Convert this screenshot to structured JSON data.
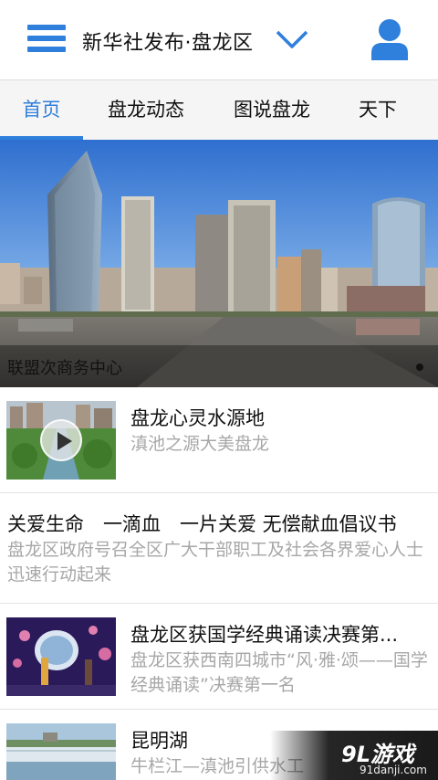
{
  "header": {
    "title": "新华社发布·盘龙区",
    "menu_icon": "hamburger-menu-icon",
    "dropdown_icon": "chevron-down-icon",
    "user_icon": "user-icon",
    "accent_color": "#2f7fdc"
  },
  "tabs": [
    {
      "label": "首页",
      "active": true
    },
    {
      "label": "盘龙动态",
      "active": false
    },
    {
      "label": "图说盘龙",
      "active": false
    },
    {
      "label": "天下",
      "active": false
    }
  ],
  "banner": {
    "caption": "联盟次商务中心"
  },
  "news": [
    {
      "title": "盘龙心灵水源地",
      "summary": "滇池之源大美盘龙",
      "has_video": true
    },
    {
      "title": "关爱生命　一滴血　一片关爱 无偿献血倡议书",
      "summary": "盘龙区政府号召全区广大干部职工及社会各界爱心人士迅速行动起来"
    },
    {
      "title": "盘龙区获国学经典诵读决赛第...",
      "summary": "盘龙区获西南四城市“风·雅·颂——国学经典诵读”决赛第一名"
    },
    {
      "title": "昆明湖",
      "summary": "牛栏江—滇池引供水工"
    }
  ],
  "watermark": {
    "logo": "9L游戏",
    "url": "91danji.com"
  }
}
